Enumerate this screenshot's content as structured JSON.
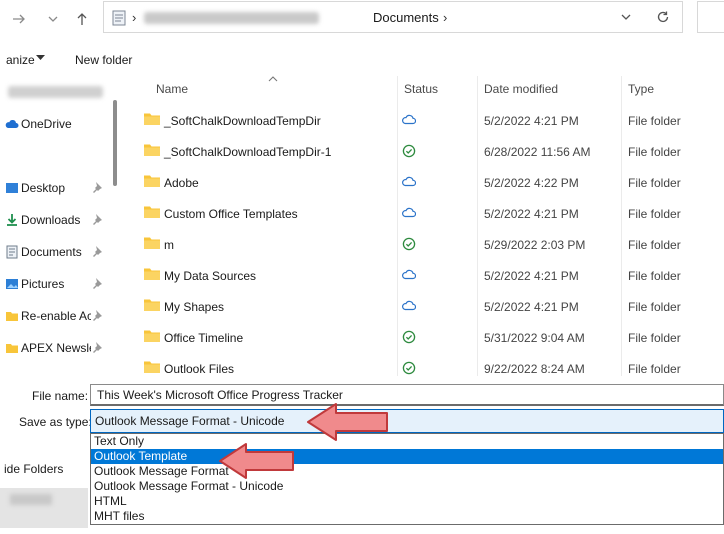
{
  "address": {
    "crumb_current": "Documents",
    "separator": "›",
    "crumb_end_separator": "›"
  },
  "toolbar": {
    "organize_label": "anize",
    "new_folder_label": "New folder"
  },
  "nav": {
    "items": [
      {
        "label": "OneDrive",
        "icon": "cloud-icon",
        "pinned": false
      },
      {
        "label": "Desktop",
        "icon": "desktop-icon",
        "pinned": true
      },
      {
        "label": "Downloads",
        "icon": "download-icon",
        "pinned": true
      },
      {
        "label": "Documents",
        "icon": "document-icon",
        "pinned": true
      },
      {
        "label": "Pictures",
        "icon": "pictures-icon",
        "pinned": true
      },
      {
        "label": "Re-enable Ac",
        "icon": "folder-icon",
        "pinned": true
      },
      {
        "label": "APEX Newsle",
        "icon": "folder-icon",
        "pinned": true
      }
    ]
  },
  "columns": {
    "name": "Name",
    "status": "Status",
    "date": "Date modified",
    "type": "Type"
  },
  "files": [
    {
      "name": "_SoftChalkDownloadTempDir",
      "status": "cloud",
      "date": "5/2/2022 4:21 PM",
      "type": "File folder"
    },
    {
      "name": "_SoftChalkDownloadTempDir-1",
      "status": "synced",
      "date": "6/28/2022 11:56 AM",
      "type": "File folder"
    },
    {
      "name": "Adobe",
      "status": "cloud",
      "date": "5/2/2022 4:22 PM",
      "type": "File folder"
    },
    {
      "name": "Custom Office Templates",
      "status": "cloud",
      "date": "5/2/2022 4:21 PM",
      "type": "File folder"
    },
    {
      "name": "m",
      "status": "synced",
      "date": "5/29/2022 2:03 PM",
      "type": "File folder"
    },
    {
      "name": "My Data Sources",
      "status": "cloud",
      "date": "5/2/2022 4:21 PM",
      "type": "File folder"
    },
    {
      "name": "My Shapes",
      "status": "cloud",
      "date": "5/2/2022 4:21 PM",
      "type": "File folder"
    },
    {
      "name": "Office Timeline",
      "status": "synced",
      "date": "5/31/2022 9:04 AM",
      "type": "File folder"
    },
    {
      "name": "Outlook Files",
      "status": "synced",
      "date": "9/22/2022 8:24 AM",
      "type": "File folder"
    }
  ],
  "form": {
    "file_name_label": "File name:",
    "file_name_value": "This Week's Microsoft Office Progress Tracker",
    "save_type_label": "Save as type:",
    "save_type_value": "Outlook Message Format - Unicode",
    "hide_folders_label": "ide Folders",
    "options": [
      {
        "label": "Text Only",
        "selected": false
      },
      {
        "label": "Outlook Template",
        "selected": true
      },
      {
        "label": "Outlook Message Format",
        "selected": false
      },
      {
        "label": "Outlook Message Format - Unicode",
        "selected": false
      },
      {
        "label": "HTML",
        "selected": false
      },
      {
        "label": "MHT files",
        "selected": false
      }
    ]
  },
  "colors": {
    "accent": "#0078d7",
    "folder": "#f8c53a",
    "cloud_status": "#2b73c9",
    "synced_status": "#2d8a3e",
    "arrow_fill": "#f08a8c",
    "arrow_stroke": "#c0393b"
  }
}
